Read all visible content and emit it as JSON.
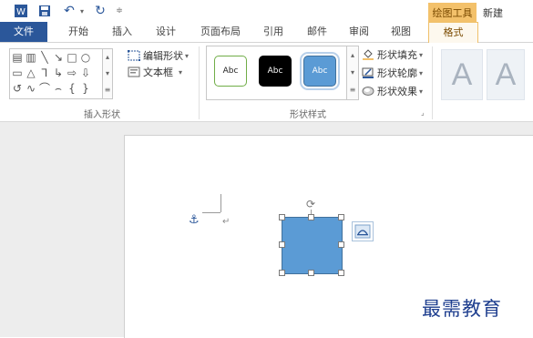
{
  "titlebar": {
    "word_logo": "W",
    "context_tab": "绘图工具",
    "new_label": "新建"
  },
  "tabs": [
    {
      "label": "文件"
    },
    {
      "label": "开始"
    },
    {
      "label": "插入"
    },
    {
      "label": "设计"
    },
    {
      "label": "页面布局"
    },
    {
      "label": "引用"
    },
    {
      "label": "邮件"
    },
    {
      "label": "审阅"
    },
    {
      "label": "视图"
    },
    {
      "label": "格式"
    }
  ],
  "ribbon": {
    "insert_shapes": {
      "edit_shape": "编辑形状",
      "text_box": "文本框",
      "group_label": "插入形状"
    },
    "shape_styles": {
      "swatches": [
        {
          "label": "Abc",
          "fill": "#ffffff",
          "text": "#222222",
          "border": "#70ad47"
        },
        {
          "label": "Abc",
          "fill": "#000000",
          "text": "#ffffff",
          "border": "#000000"
        },
        {
          "label": "Abc",
          "fill": "#5b9bd5",
          "text": "#ffffff",
          "border": "#41719c"
        }
      ],
      "shape_fill": "形状填充",
      "shape_outline": "形状轮廓",
      "shape_effects": "形状效果",
      "group_label": "形状样式"
    },
    "wordart": {
      "letter": "A"
    }
  },
  "document": {
    "shape_color": "#5b9bd5",
    "paragraph_mark": "↵"
  },
  "watermark": "最需教育",
  "colors": {
    "accent": "#2b579a",
    "context": "#f3c16b"
  }
}
